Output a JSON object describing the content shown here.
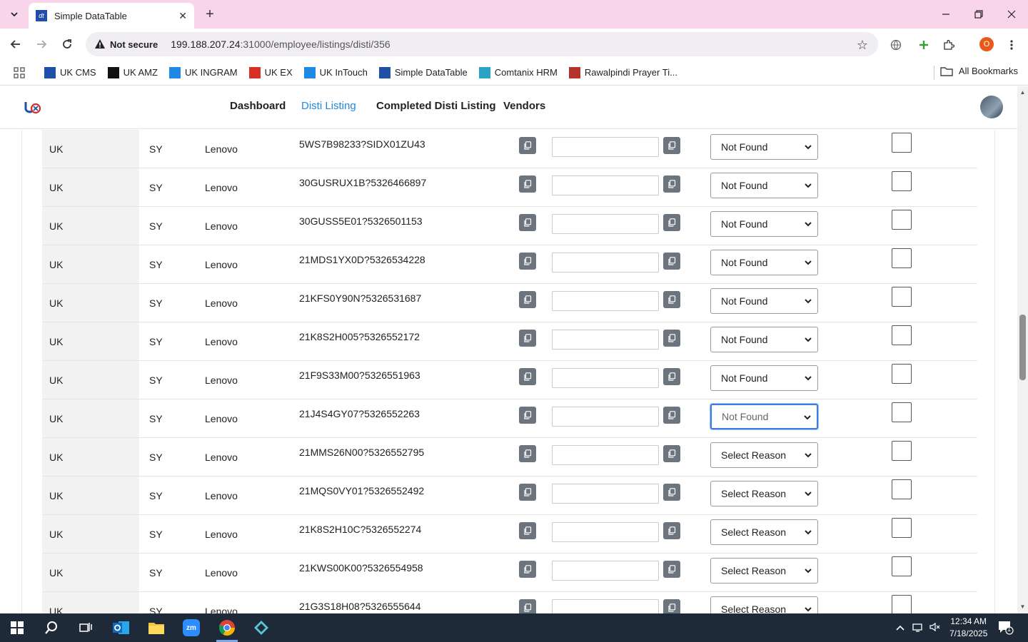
{
  "browser": {
    "tab_title": "Simple DataTable",
    "security_label": "Not secure",
    "url_host": "199.188.207.24",
    "url_path": ":31000/employee/listings/disti/356",
    "profile_initial": "O",
    "bookmarks": [
      {
        "label": "UK CMS",
        "icon": "uk-cms-icon",
        "color": "#1f4fa6"
      },
      {
        "label": "UK AMZ",
        "icon": "amazon-icon",
        "color": "#111111"
      },
      {
        "label": "UK INGRAM",
        "icon": "ingram-icon",
        "color": "#1e88e5"
      },
      {
        "label": "UK EX",
        "icon": "ex-icon",
        "color": "#d93025"
      },
      {
        "label": "UK InTouch",
        "icon": "intouch-icon",
        "color": "#1e88e5"
      },
      {
        "label": "Simple DataTable",
        "icon": "datatable-icon",
        "color": "#1f4fa6"
      },
      {
        "label": "Comtanix HRM",
        "icon": "hrm-icon",
        "color": "#2aa3c7"
      },
      {
        "label": "Rawalpindi Prayer Ti...",
        "icon": "prayer-icon",
        "color": "#b5332a"
      }
    ],
    "all_bookmarks": "All Bookmarks"
  },
  "app": {
    "nav": [
      {
        "label": "Dashboard",
        "active": false
      },
      {
        "label": "Disti Listing",
        "active": true
      },
      {
        "label": "Completed Disti Listing",
        "active": false
      },
      {
        "label": "Vendors",
        "active": false
      }
    ]
  },
  "rows": [
    {
      "country": "UK",
      "condition": "SY",
      "brand": "Lenovo",
      "sku": "5WS7B98233?SIDX01ZU43",
      "input": "",
      "reason": "Not Found",
      "focused": false
    },
    {
      "country": "UK",
      "condition": "SY",
      "brand": "Lenovo",
      "sku": "30GUSRUX1B?5326466897",
      "input": "",
      "reason": "Not Found",
      "focused": false
    },
    {
      "country": "UK",
      "condition": "SY",
      "brand": "Lenovo",
      "sku": "30GUSS5E01?5326501153",
      "input": "",
      "reason": "Not Found",
      "focused": false
    },
    {
      "country": "UK",
      "condition": "SY",
      "brand": "Lenovo",
      "sku": "21MDS1YX0D?5326534228",
      "input": "",
      "reason": "Not Found",
      "focused": false
    },
    {
      "country": "UK",
      "condition": "SY",
      "brand": "Lenovo",
      "sku": "21KFS0Y90N?5326531687",
      "input": "",
      "reason": "Not Found",
      "focused": false
    },
    {
      "country": "UK",
      "condition": "SY",
      "brand": "Lenovo",
      "sku": "21K8S2H005?5326552172",
      "input": "",
      "reason": "Not Found",
      "focused": false
    },
    {
      "country": "UK",
      "condition": "SY",
      "brand": "Lenovo",
      "sku": "21F9S33M00?5326551963",
      "input": "",
      "reason": "Not Found",
      "focused": false
    },
    {
      "country": "UK",
      "condition": "SY",
      "brand": "Lenovo",
      "sku": "21J4S4GY07?5326552263",
      "input": "",
      "reason": "Not Found",
      "focused": true
    },
    {
      "country": "UK",
      "condition": "SY",
      "brand": "Lenovo",
      "sku": "21MMS26N00?5326552795",
      "input": "",
      "reason": "Select Reason",
      "focused": false
    },
    {
      "country": "UK",
      "condition": "SY",
      "brand": "Lenovo",
      "sku": "21MQS0VY01?5326552492",
      "input": "",
      "reason": "Select Reason",
      "focused": false
    },
    {
      "country": "UK",
      "condition": "SY",
      "brand": "Lenovo",
      "sku": "21K8S2H10C?5326552274",
      "input": "",
      "reason": "Select Reason",
      "focused": false
    },
    {
      "country": "UK",
      "condition": "SY",
      "brand": "Lenovo",
      "sku": "21KWS00K00?5326554958",
      "input": "",
      "reason": "Select Reason",
      "focused": false
    },
    {
      "country": "UK",
      "condition": "SY",
      "brand": "Lenovo",
      "sku": "21G3S18H08?5326555644",
      "input": "",
      "reason": "Select Reason",
      "focused": false
    }
  ],
  "taskbar": {
    "time": "12:34 AM",
    "date": "7/18/2025",
    "notification_count": "1"
  }
}
